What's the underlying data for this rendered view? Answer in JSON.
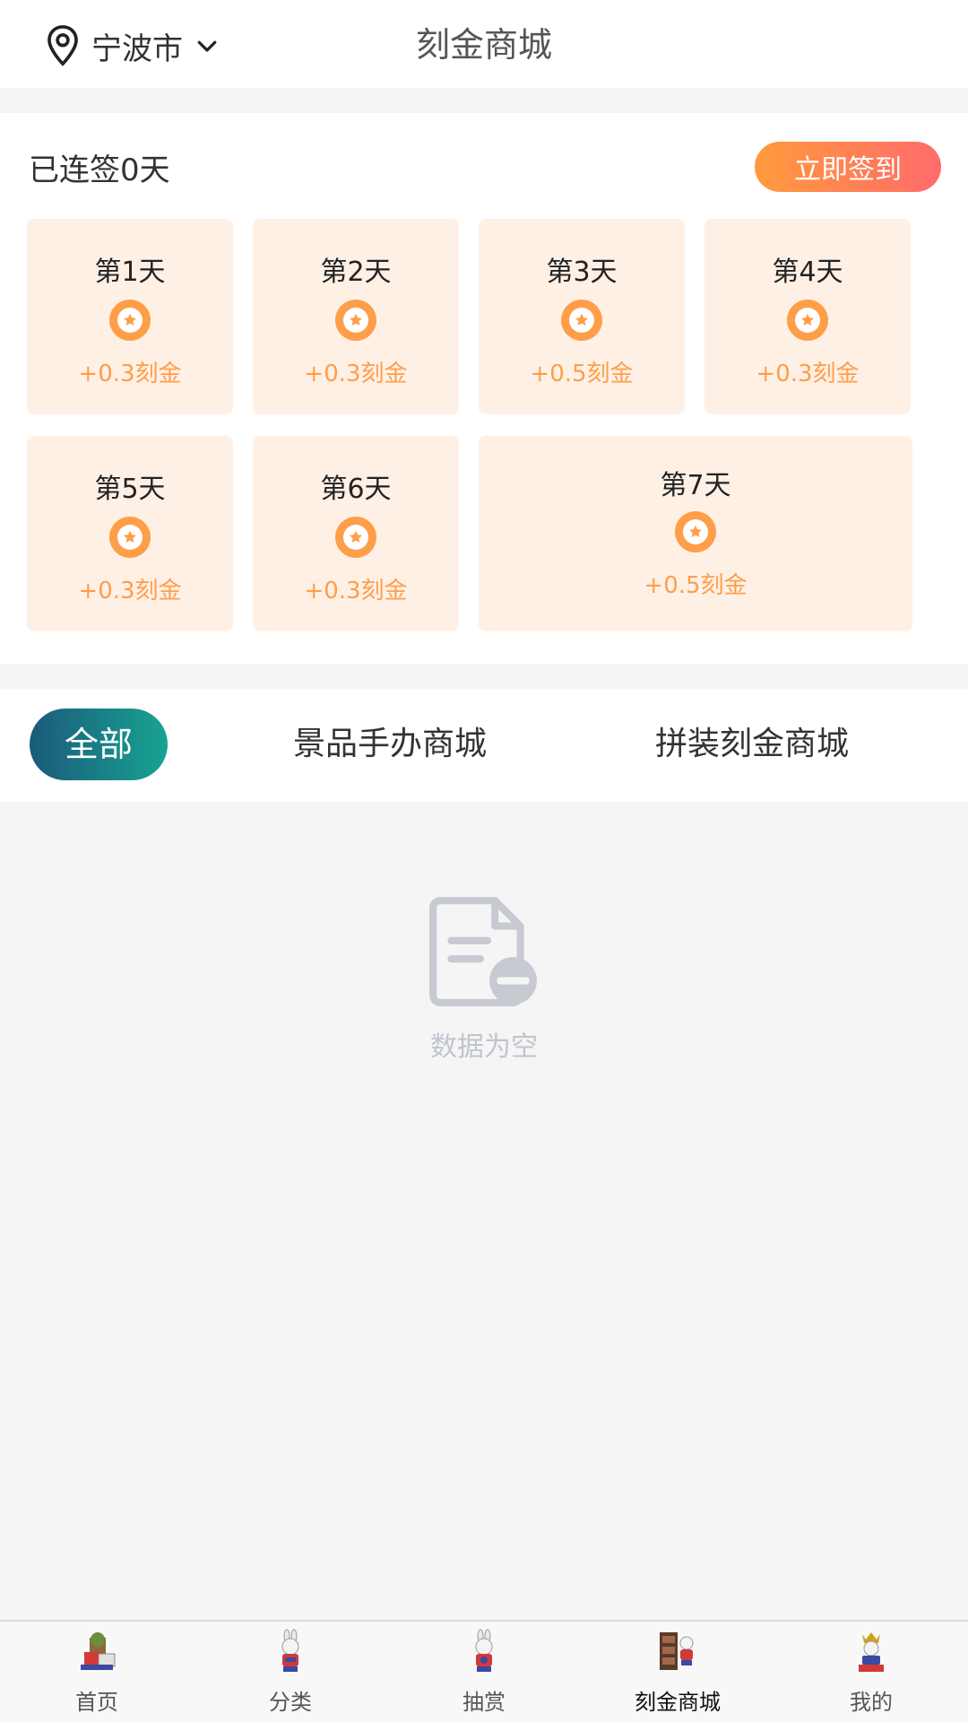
{
  "header": {
    "city": "宁波市",
    "title": "刻金商城",
    "icons": [
      "location-pin-icon",
      "chevron-down-icon"
    ]
  },
  "signin": {
    "streak_text": "已连签0天",
    "button_label": "立即签到",
    "days": [
      {
        "label": "第1天",
        "reward": "+0.3刻金"
      },
      {
        "label": "第2天",
        "reward": "+0.3刻金"
      },
      {
        "label": "第3天",
        "reward": "+0.5刻金"
      },
      {
        "label": "第4天",
        "reward": "+0.3刻金"
      },
      {
        "label": "第5天",
        "reward": "+0.3刻金"
      },
      {
        "label": "第6天",
        "reward": "+0.3刻金"
      },
      {
        "label": "第7天",
        "reward": "+0.5刻金"
      }
    ],
    "reward_icon": "coin-flower-icon",
    "accent": "#ff9e48",
    "card_bg": "#fff0e6"
  },
  "category_tabs": [
    {
      "label": "全部",
      "active": true
    },
    {
      "label": "景品手办商城",
      "active": false
    },
    {
      "label": "拼装刻金商城",
      "active": false
    }
  ],
  "empty_state": {
    "icon": "document-empty-icon",
    "text": "数据为空"
  },
  "tabbar": [
    {
      "label": "首页",
      "icon": "home-icon",
      "active": false
    },
    {
      "label": "分类",
      "icon": "category-icon",
      "active": false
    },
    {
      "label": "抽赏",
      "icon": "lottery-icon",
      "active": false
    },
    {
      "label": "刻金商城",
      "icon": "shop-icon",
      "active": true
    },
    {
      "label": "我的",
      "icon": "profile-icon",
      "active": false
    }
  ],
  "colors": {
    "tab_active_start": "#1a5a7a",
    "tab_active_end": "#18a392",
    "sign_btn_start": "#ff9a3c",
    "sign_btn_end": "#ff6b6b"
  }
}
